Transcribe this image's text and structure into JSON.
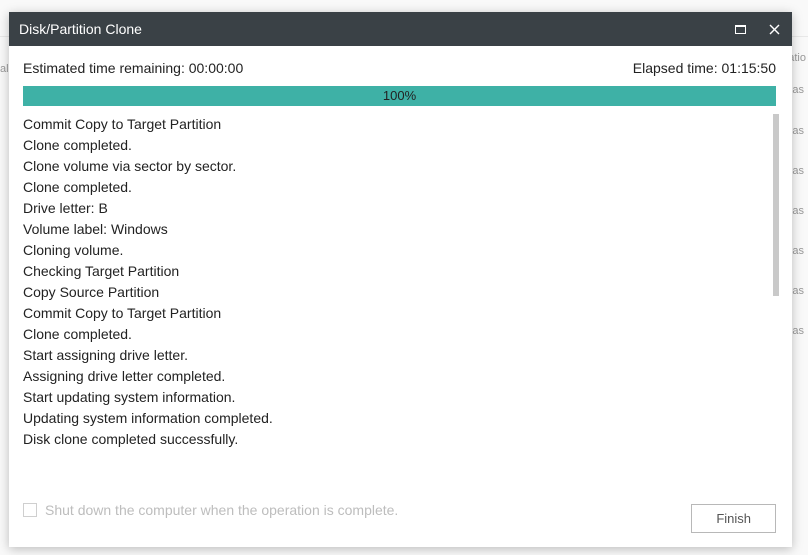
{
  "titlebar": {
    "title": "Disk/Partition Clone"
  },
  "times": {
    "remaining_label": "Estimated time remaining:",
    "remaining_value": "00:00:00",
    "elapsed_label": "Elapsed time:",
    "elapsed_value": "01:15:50"
  },
  "progress": {
    "percent_label": "100%",
    "percent": 100
  },
  "log": [
    "Commit Copy to Target Partition",
    "Clone completed.",
    "Clone volume via sector by sector.",
    "Clone completed.",
    "Drive letter: B",
    "Volume label: Windows",
    "Cloning volume.",
    "Checking Target Partition",
    "Copy Source Partition",
    "Commit Copy to Target Partition",
    "Clone completed.",
    "Start assigning drive letter.",
    "Assigning drive letter completed.",
    "Start updating system information.",
    "Updating system information completed.",
    "Disk clone completed successfully."
  ],
  "shutdown": {
    "label": "Shut down the computer when the operation is complete.",
    "checked": false
  },
  "buttons": {
    "finish": "Finish"
  },
  "background_hints": {
    "left_fragment": "al",
    "right_fragments": [
      "atio",
      "as",
      "as",
      "as",
      "as",
      "as",
      "as",
      "as"
    ]
  }
}
